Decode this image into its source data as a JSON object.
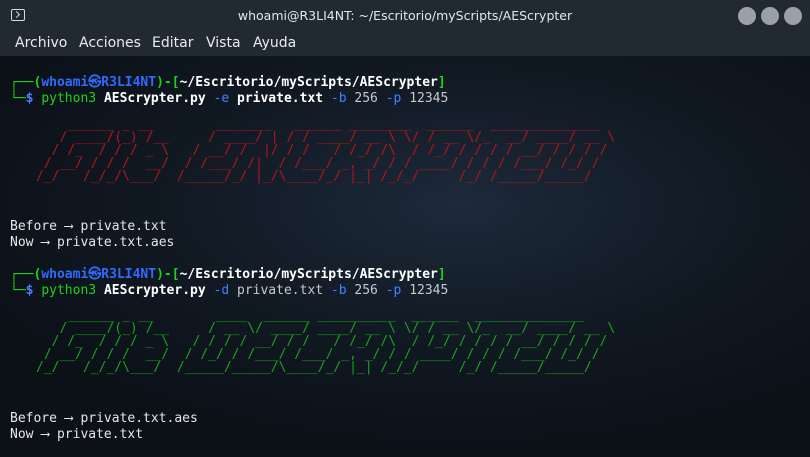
{
  "window": {
    "title": "whoami@R3LI4NT: ~/Escritorio/myScripts/AEScrypter",
    "buttons": [
      "minimize",
      "maximize",
      "close"
    ]
  },
  "menu": [
    "Archivo",
    "Acciones",
    "Editar",
    "Vista",
    "Ayuda"
  ],
  "prompt": {
    "user": "whoami",
    "at": "㉿",
    "host": "R3LI4NT",
    "path": "~/Escritorio/myScripts/AEScrypter",
    "symbol": "$"
  },
  "commands": [
    {
      "interp": "python3",
      "script": "AEScrypter.py",
      "mode_flag": "-e",
      "file": "private.txt",
      "bits_flag": "-b",
      "bits": "256",
      "pass_flag": "-p",
      "pass": "12345"
    },
    {
      "interp": "python3",
      "script": "AEScrypter.py",
      "mode_flag": "-d",
      "file": "private.txt",
      "bits_flag": "-b",
      "bits": "256",
      "pass_flag": "-p",
      "pass": "12345"
    }
  ],
  "banners": {
    "encrypted": "File ENCRYPTED",
    "decrypted": "File DECRYPTED",
    "encrypted_color": "#b5161a",
    "decrypted_color": "#1aa51a"
  },
  "results": [
    {
      "before": "Before ⟶ private.txt",
      "now": "Now ⟶ private.txt.aes"
    },
    {
      "before": "Before ⟶ private.txt.aes",
      "now": "Now ⟶ private.txt"
    }
  ],
  "colors": {
    "titlebar": "#212933",
    "prompt_frame": "#1fd21f",
    "prompt_user": "#2f6bff",
    "terminal_bg": "#111923"
  }
}
